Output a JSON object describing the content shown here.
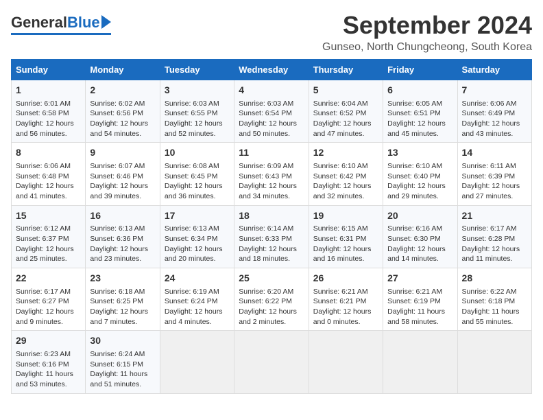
{
  "logo": {
    "general": "General",
    "blue": "Blue"
  },
  "title": "September 2024",
  "subtitle": "Gunseo, North Chungcheong, South Korea",
  "days_of_week": [
    "Sunday",
    "Monday",
    "Tuesday",
    "Wednesday",
    "Thursday",
    "Friday",
    "Saturday"
  ],
  "weeks": [
    [
      {
        "day": 1,
        "sunrise": "6:01 AM",
        "sunset": "6:58 PM",
        "daylight": "12 hours and 56 minutes."
      },
      {
        "day": 2,
        "sunrise": "6:02 AM",
        "sunset": "6:56 PM",
        "daylight": "12 hours and 54 minutes."
      },
      {
        "day": 3,
        "sunrise": "6:03 AM",
        "sunset": "6:55 PM",
        "daylight": "12 hours and 52 minutes."
      },
      {
        "day": 4,
        "sunrise": "6:03 AM",
        "sunset": "6:54 PM",
        "daylight": "12 hours and 50 minutes."
      },
      {
        "day": 5,
        "sunrise": "6:04 AM",
        "sunset": "6:52 PM",
        "daylight": "12 hours and 47 minutes."
      },
      {
        "day": 6,
        "sunrise": "6:05 AM",
        "sunset": "6:51 PM",
        "daylight": "12 hours and 45 minutes."
      },
      {
        "day": 7,
        "sunrise": "6:06 AM",
        "sunset": "6:49 PM",
        "daylight": "12 hours and 43 minutes."
      }
    ],
    [
      {
        "day": 8,
        "sunrise": "6:06 AM",
        "sunset": "6:48 PM",
        "daylight": "12 hours and 41 minutes."
      },
      {
        "day": 9,
        "sunrise": "6:07 AM",
        "sunset": "6:46 PM",
        "daylight": "12 hours and 39 minutes."
      },
      {
        "day": 10,
        "sunrise": "6:08 AM",
        "sunset": "6:45 PM",
        "daylight": "12 hours and 36 minutes."
      },
      {
        "day": 11,
        "sunrise": "6:09 AM",
        "sunset": "6:43 PM",
        "daylight": "12 hours and 34 minutes."
      },
      {
        "day": 12,
        "sunrise": "6:10 AM",
        "sunset": "6:42 PM",
        "daylight": "12 hours and 32 minutes."
      },
      {
        "day": 13,
        "sunrise": "6:10 AM",
        "sunset": "6:40 PM",
        "daylight": "12 hours and 29 minutes."
      },
      {
        "day": 14,
        "sunrise": "6:11 AM",
        "sunset": "6:39 PM",
        "daylight": "12 hours and 27 minutes."
      }
    ],
    [
      {
        "day": 15,
        "sunrise": "6:12 AM",
        "sunset": "6:37 PM",
        "daylight": "12 hours and 25 minutes."
      },
      {
        "day": 16,
        "sunrise": "6:13 AM",
        "sunset": "6:36 PM",
        "daylight": "12 hours and 23 minutes."
      },
      {
        "day": 17,
        "sunrise": "6:13 AM",
        "sunset": "6:34 PM",
        "daylight": "12 hours and 20 minutes."
      },
      {
        "day": 18,
        "sunrise": "6:14 AM",
        "sunset": "6:33 PM",
        "daylight": "12 hours and 18 minutes."
      },
      {
        "day": 19,
        "sunrise": "6:15 AM",
        "sunset": "6:31 PM",
        "daylight": "12 hours and 16 minutes."
      },
      {
        "day": 20,
        "sunrise": "6:16 AM",
        "sunset": "6:30 PM",
        "daylight": "12 hours and 14 minutes."
      },
      {
        "day": 21,
        "sunrise": "6:17 AM",
        "sunset": "6:28 PM",
        "daylight": "12 hours and 11 minutes."
      }
    ],
    [
      {
        "day": 22,
        "sunrise": "6:17 AM",
        "sunset": "6:27 PM",
        "daylight": "12 hours and 9 minutes."
      },
      {
        "day": 23,
        "sunrise": "6:18 AM",
        "sunset": "6:25 PM",
        "daylight": "12 hours and 7 minutes."
      },
      {
        "day": 24,
        "sunrise": "6:19 AM",
        "sunset": "6:24 PM",
        "daylight": "12 hours and 4 minutes."
      },
      {
        "day": 25,
        "sunrise": "6:20 AM",
        "sunset": "6:22 PM",
        "daylight": "12 hours and 2 minutes."
      },
      {
        "day": 26,
        "sunrise": "6:21 AM",
        "sunset": "6:21 PM",
        "daylight": "12 hours and 0 minutes."
      },
      {
        "day": 27,
        "sunrise": "6:21 AM",
        "sunset": "6:19 PM",
        "daylight": "11 hours and 58 minutes."
      },
      {
        "day": 28,
        "sunrise": "6:22 AM",
        "sunset": "6:18 PM",
        "daylight": "11 hours and 55 minutes."
      }
    ],
    [
      {
        "day": 29,
        "sunrise": "6:23 AM",
        "sunset": "6:16 PM",
        "daylight": "11 hours and 53 minutes."
      },
      {
        "day": 30,
        "sunrise": "6:24 AM",
        "sunset": "6:15 PM",
        "daylight": "11 hours and 51 minutes."
      },
      null,
      null,
      null,
      null,
      null
    ]
  ],
  "labels": {
    "sunrise": "Sunrise:",
    "sunset": "Sunset:",
    "daylight": "Daylight:"
  }
}
